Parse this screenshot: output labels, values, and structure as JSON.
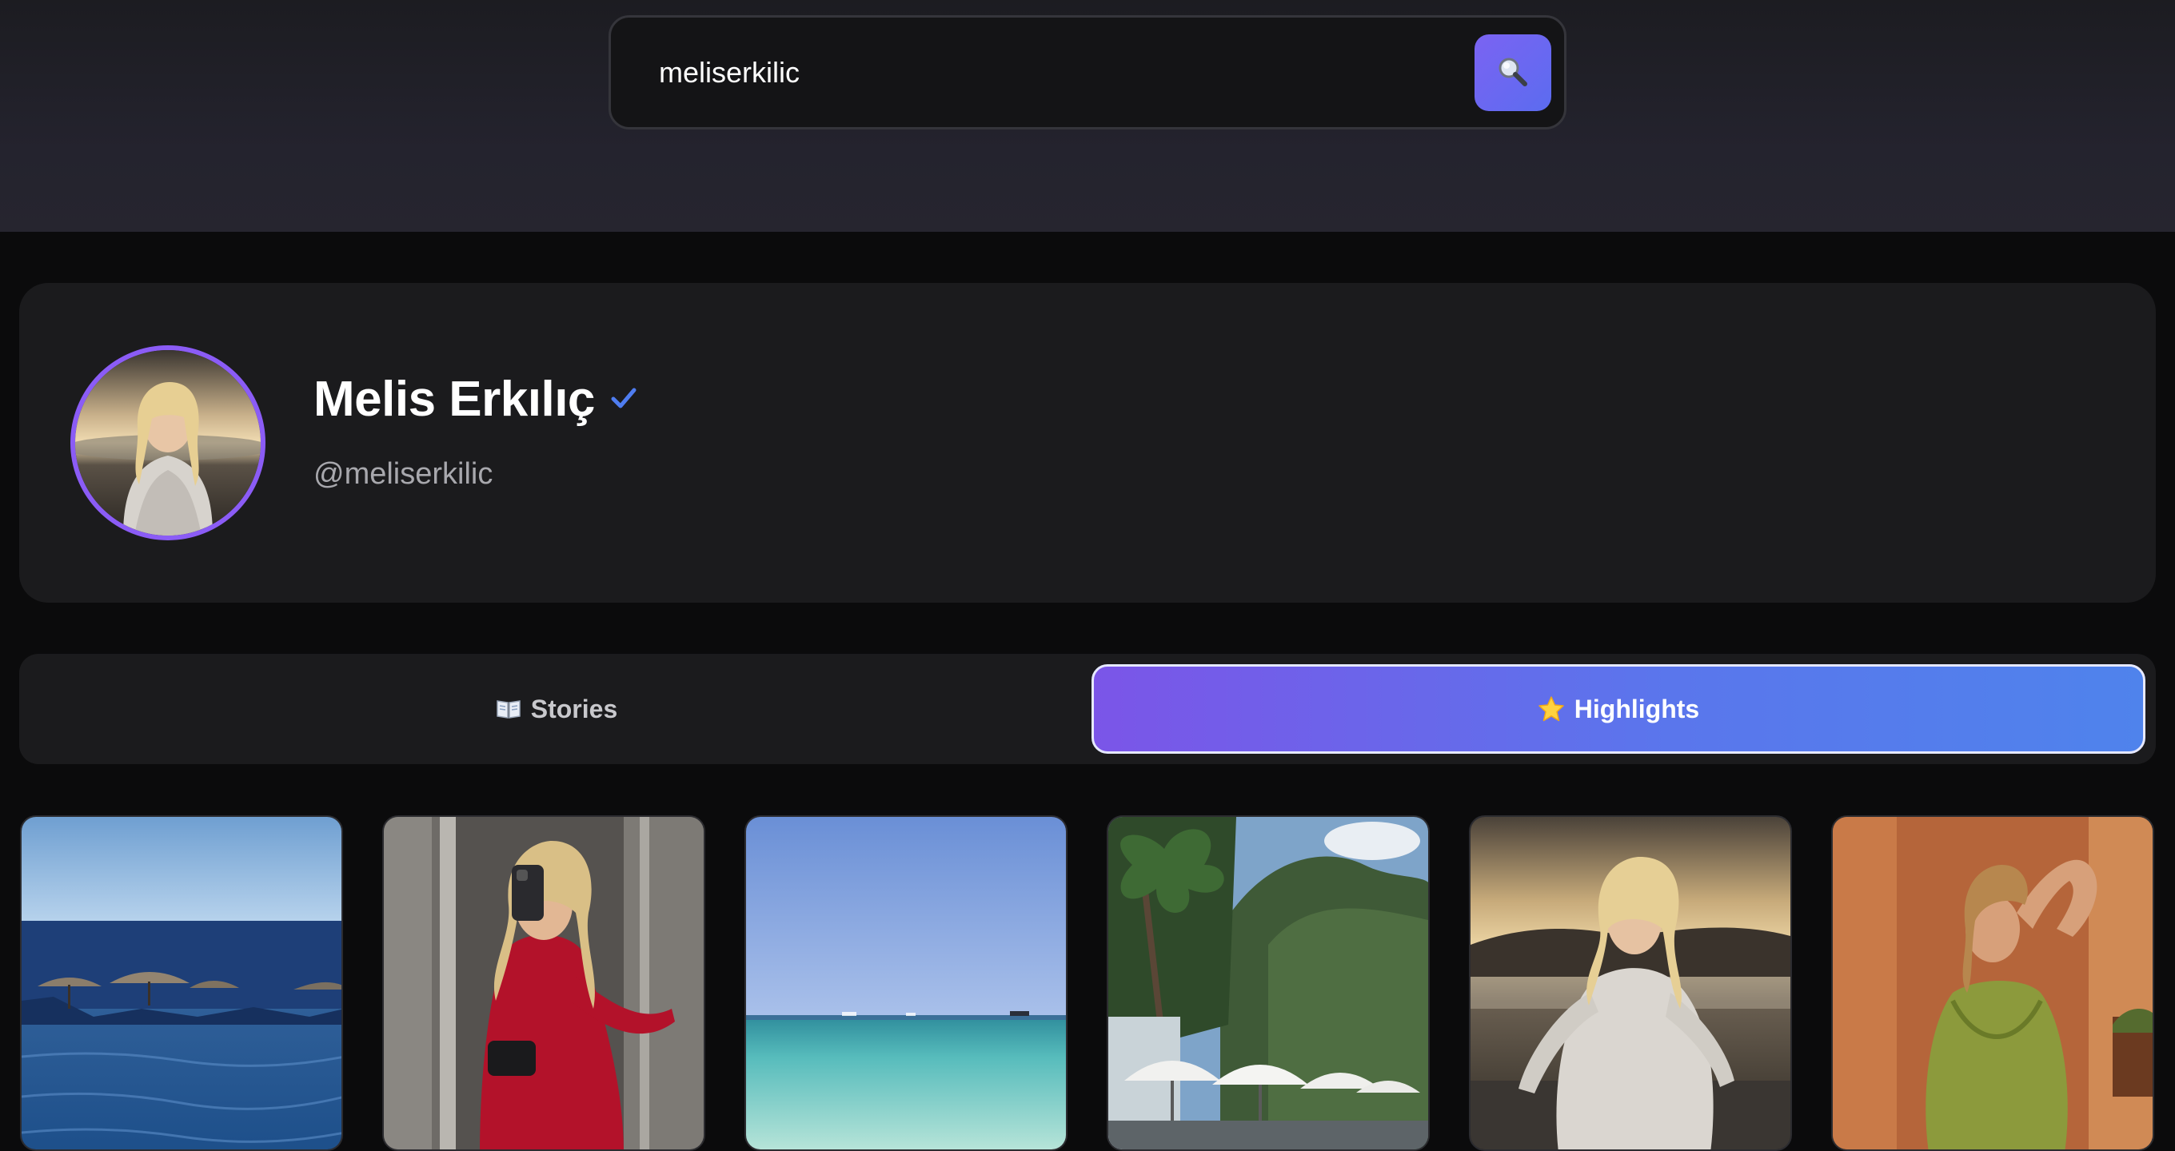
{
  "search": {
    "value": "meliserkilic",
    "button_icon": "search-icon"
  },
  "profile": {
    "name": "Melis Erkılıç",
    "handle": "@meliserkilic",
    "verified": true,
    "verified_icon": "check-icon",
    "avatar_ring_color": "#8b5cf6"
  },
  "tabs": [
    {
      "label": "Stories",
      "icon": "book-icon",
      "active": false
    },
    {
      "label": "Highlights",
      "icon": "star-icon",
      "active": true
    }
  ],
  "highlights": [
    {
      "thumbnail": "infinity-pool-sea-umbrellas"
    },
    {
      "thumbnail": "mirror-selfie-red-dress"
    },
    {
      "thumbnail": "clear-turquoise-sea"
    },
    {
      "thumbnail": "palm-trees-mountain-cafe"
    },
    {
      "thumbnail": "white-lace-dress-sunset-lake"
    },
    {
      "thumbnail": "green-dress-salute-pose"
    }
  ],
  "colors": {
    "accent": "#7b63f2",
    "active_tab_start": "#7b55e8",
    "active_tab_end": "#4f83ec",
    "verified": "#4f7df0"
  }
}
